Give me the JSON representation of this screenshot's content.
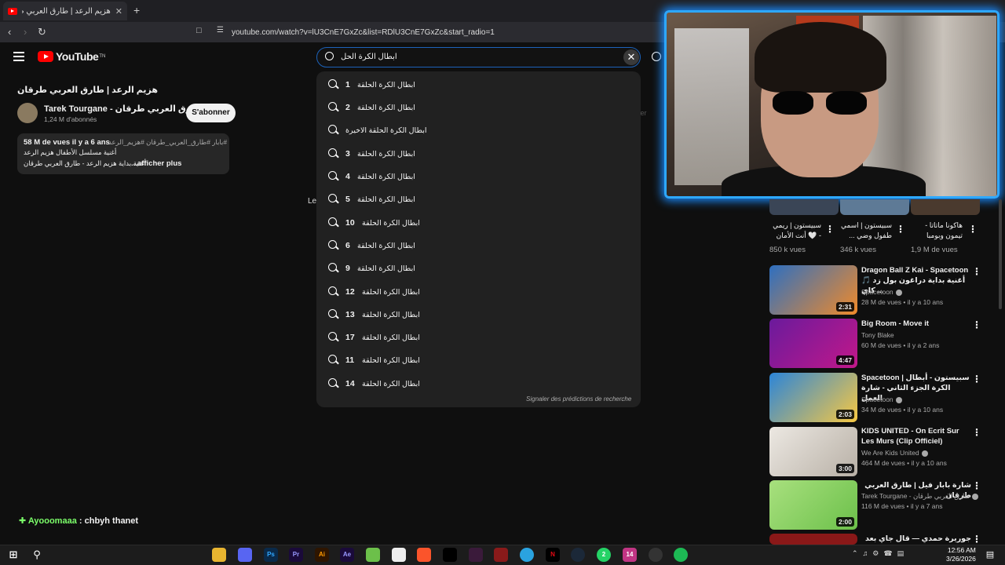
{
  "browser": {
    "tab_title": "هزيم الرعد | طارق العربي طرقان -",
    "tab_close": "✕",
    "new_tab": "+",
    "url": "youtube.com/watch?v=lU3CnE7GxZc&list=RDlU3CnE7GxZc&start_radio=1"
  },
  "header": {
    "logo_text": "YouTube",
    "logo_sup": "TN",
    "search_value": "ابطال الكرة الحل",
    "clear_label": "✕"
  },
  "video": {
    "title": "هزيم الرعد | طارق العربي طرقان",
    "channel": "Tarek Tourgane - طارق العربي طرقان",
    "subscribers": "1,24 M d'abonnés",
    "subscribe_label": "S'abonner",
    "desc_views": "58 M de vues  il y a 6 ans",
    "desc_tags": "#بابار #طارق_العربي_طرقان #هزيم_الرعد",
    "desc_line1": "أغنية مسلسل الأطفال هزيم الرعد",
    "desc_line2": "أغنية بداية هزيم الرعد - طارق العربي طرقان",
    "desc_more": "...afficher plus",
    "fragment_left": "Le",
    "fragment_right": "itrer"
  },
  "suggestions": [
    {
      "num": "1",
      "text": "ابطال الكرة الحلقة"
    },
    {
      "num": "2",
      "text": "ابطال الكرة الحلقة"
    },
    {
      "num": "",
      "text": "ابطال الكرة الحلقة الاخيرة"
    },
    {
      "num": "3",
      "text": "ابطال الكرة الحلقة"
    },
    {
      "num": "4",
      "text": "ابطال الكرة الحلقة"
    },
    {
      "num": "5",
      "text": "ابطال الكرة الحلقة"
    },
    {
      "num": "10",
      "text": "ابطال الكرة الحلقة"
    },
    {
      "num": "6",
      "text": "ابطال الكرة الحلقة"
    },
    {
      "num": "9",
      "text": "ابطال الكرة الحلقة"
    },
    {
      "num": "12",
      "text": "ابطال الكرة الحلقة"
    },
    {
      "num": "13",
      "text": "ابطال الكرة الحلقة"
    },
    {
      "num": "17",
      "text": "ابطال الكرة الحلقة"
    },
    {
      "num": "11",
      "text": "ابطال الكرة الحلقة"
    },
    {
      "num": "14",
      "text": "ابطال الكرة الحلقة"
    }
  ],
  "report_label": "Signaler des prédictions de recherche",
  "shorts": [
    {
      "title": "سبيستون | ريمي - 🤍 أنت الأمان",
      "views": "850 k vues"
    },
    {
      "title": "سبيستون | اسمي طفول وضي ...",
      "views": "346 k vues"
    },
    {
      "title": "هاكونا ماتاتا - تيمون وبومبا",
      "views": "1,9 M de vues"
    }
  ],
  "recommendations": [
    {
      "title": "Dragon Ball Z Kai - Spacetoon 🎵 أغنية بداية دراغون بول زد كاي ...",
      "channel": "Spacetoon",
      "meta": "28 M de vues • il y a 10 ans",
      "duration": "2:31",
      "color": "#3a8fd6",
      "rtl": false
    },
    {
      "title": "Big Room - Move it",
      "channel": "Tony Blake",
      "meta": "60 M de vues • il y a 2 ans",
      "duration": "4:47",
      "color": "#7a1fa8",
      "rtl": false
    },
    {
      "title": "Spacetoon | سبيستون - أبطال الكرة الجزء الثاني - شارة العمل",
      "channel": "Spacetoon",
      "meta": "34 M de vues • il y a 10 ans",
      "duration": "2:03",
      "color": "#2e7fd0",
      "rtl": false
    },
    {
      "title": "KIDS UNITED - On Ecrit Sur Les Murs (Clip Officiel)",
      "channel": "We Are Kids United",
      "meta": "464 M de vues • il y a 10 ans",
      "duration": "3:00",
      "color": "#d8d4cf",
      "rtl": false
    },
    {
      "title": "شارة بابار فيل | طارق العربي طرقان",
      "channel": "Tarek Tourgane - طارق العربي طرقان",
      "meta": "116 M de vues • il y a 7 ans",
      "duration": "2:00",
      "color": "#8fd96a",
      "rtl": true
    },
    {
      "title": "جوريرة حمدي — قال جاي بعد يومين",
      "channel": "",
      "meta": "",
      "duration": "",
      "color": "#b02020",
      "rtl": true
    }
  ],
  "chat": {
    "user": "Ayooomaaa",
    "message": ": chbyh thanet"
  },
  "taskbar": {
    "time": "12:56 AM",
    "date": "3/26/2026",
    "badge_whatsapp": "2",
    "badge_insta": "14"
  }
}
